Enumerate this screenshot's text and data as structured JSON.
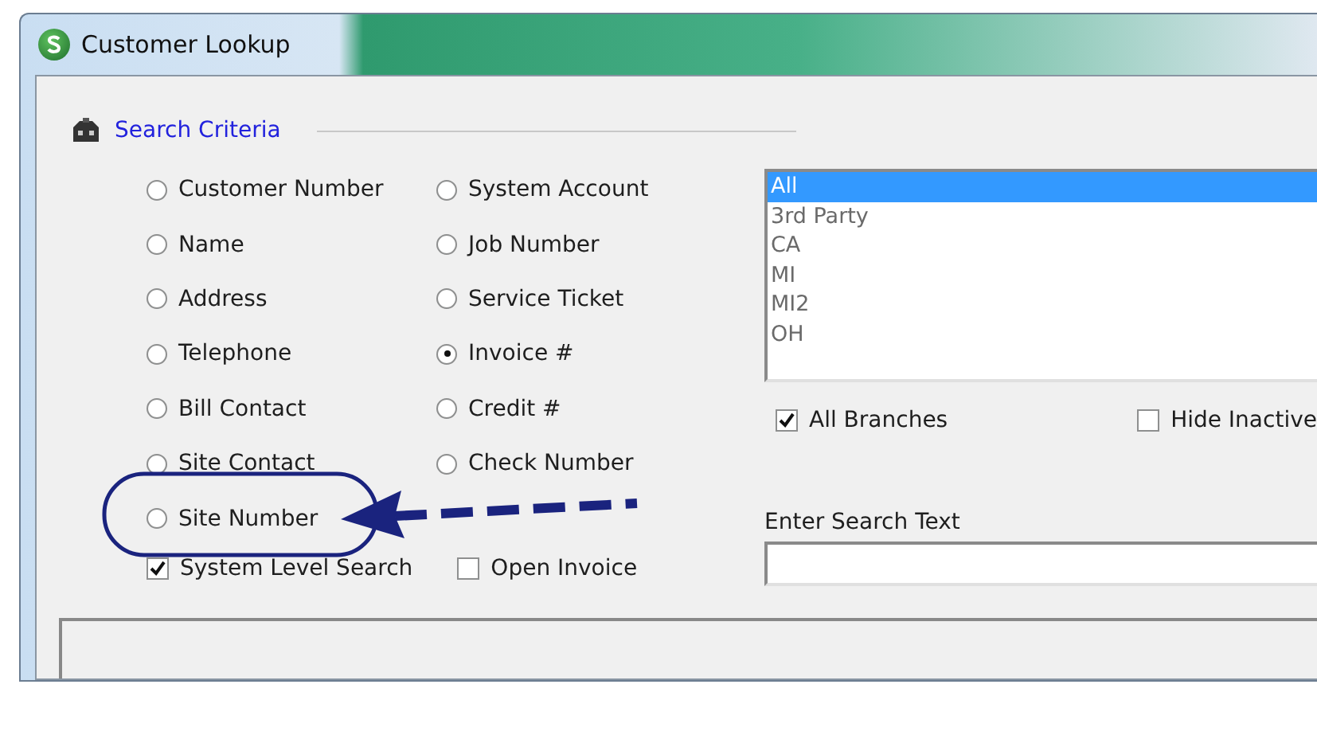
{
  "window": {
    "title": "Customer Lookup"
  },
  "search_criteria": {
    "title": "Search Criteria",
    "columns": [
      [
        {
          "label": "Customer Number",
          "selected": false
        },
        {
          "label": "Name",
          "selected": false
        },
        {
          "label": "Address",
          "selected": false
        },
        {
          "label": "Telephone",
          "selected": false
        },
        {
          "label": "Bill Contact",
          "selected": false
        },
        {
          "label": "Site Contact",
          "selected": false
        },
        {
          "label": "Site Number",
          "selected": false
        }
      ],
      [
        {
          "label": "System Account",
          "selected": false
        },
        {
          "label": "Job Number",
          "selected": false
        },
        {
          "label": "Service Ticket",
          "selected": false
        },
        {
          "label": "Invoice #",
          "selected": true
        },
        {
          "label": "Credit #",
          "selected": false
        },
        {
          "label": "Check Number",
          "selected": false
        }
      ]
    ],
    "checkboxes": [
      {
        "label": "System Level Search",
        "checked": true
      },
      {
        "label": "Open Invoice",
        "checked": false
      }
    ]
  },
  "branches": {
    "items": [
      {
        "label": "All",
        "selected": true
      },
      {
        "label": "3rd Party",
        "selected": false
      },
      {
        "label": "CA",
        "selected": false
      },
      {
        "label": "MI",
        "selected": false
      },
      {
        "label": "MI2",
        "selected": false
      },
      {
        "label": "OH",
        "selected": false
      }
    ],
    "checkboxes": [
      {
        "label": "All Branches",
        "checked": true
      },
      {
        "label": "Hide Inactive",
        "checked": false
      }
    ]
  },
  "search_text": {
    "label": "Enter Search Text"
  }
}
